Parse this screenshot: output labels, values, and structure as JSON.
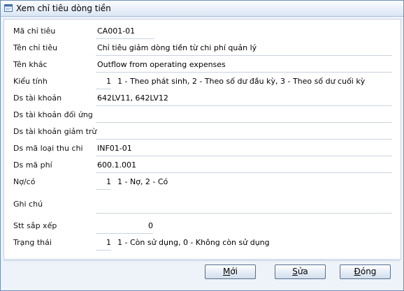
{
  "window": {
    "title": "Xem chỉ tiêu dòng tiền"
  },
  "fields": {
    "ma_chi_tieu": {
      "label": "Mã chỉ tiêu",
      "value": "CA001-01"
    },
    "ten_chi_tieu": {
      "label": "Tên chỉ tiêu",
      "value": "Chỉ tiêu giảm dòng tiền từ chi phí quản lý"
    },
    "ten_khac": {
      "label": "Tên khác",
      "value": "Outflow from operating expenses"
    },
    "kieu_tinh": {
      "label": "Kiểu tính",
      "value": "1",
      "hint": "1 - Theo phát sinh, 2 - Theo số dư đầu kỳ, 3 - Theo số dư cuối kỳ"
    },
    "ds_tai_khoan": {
      "label": "Ds tài khoản",
      "value": "642LV11, 642LV12"
    },
    "ds_tk_doi_ung": {
      "label": "Ds tài khoản đối ứng",
      "value": ""
    },
    "ds_tk_giam_tru": {
      "label": "Ds tài khoản giảm trừ",
      "value": ""
    },
    "ds_ma_loai_thu_chi": {
      "label": "Ds mã loại thu chi",
      "value": "INF01-01"
    },
    "ds_ma_phi": {
      "label": "Ds mã phí",
      "value": "600.1.001"
    },
    "no_co": {
      "label": "Nợ/có",
      "value": "1",
      "hint": "1 - Nợ, 2 - Có"
    },
    "ghi_chu": {
      "label": "Ghi chú",
      "value": ""
    },
    "stt_sap_xep": {
      "label": "Stt sắp xếp",
      "value": "0"
    },
    "trang_thai": {
      "label": "Trạng thái",
      "value": "1",
      "hint": "1 - Còn sử dụng, 0 - Không còn sử dụng"
    }
  },
  "buttons": {
    "moi": {
      "label_accel": "M",
      "label_rest": "ới"
    },
    "sua": {
      "label_accel": "S",
      "label_rest": "ửa"
    },
    "dong": {
      "label_accel": "Đ",
      "label_rest": "óng"
    }
  }
}
